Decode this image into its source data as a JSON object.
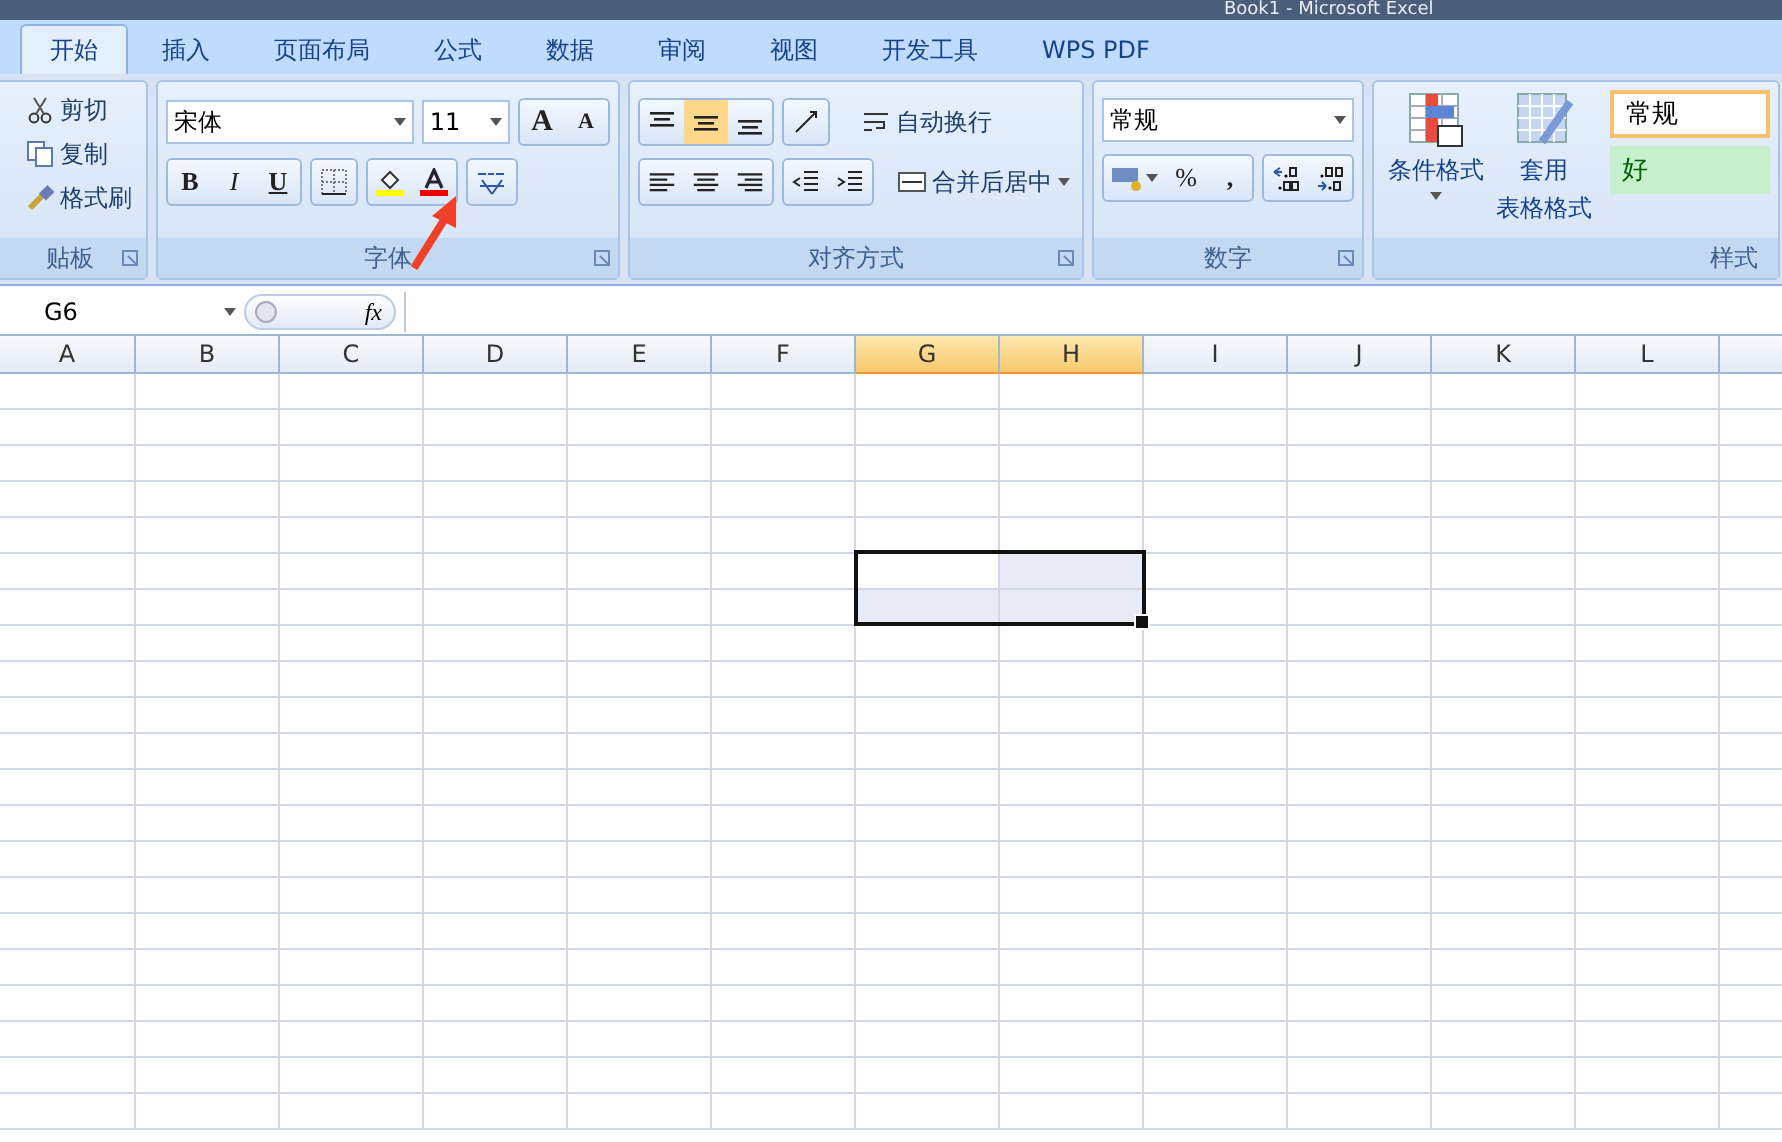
{
  "window": {
    "title": "Book1 - Microsoft Excel"
  },
  "tabs": [
    {
      "label": "开始",
      "selected": true
    },
    {
      "label": "插入",
      "selected": false
    },
    {
      "label": "页面布局",
      "selected": false
    },
    {
      "label": "公式",
      "selected": false
    },
    {
      "label": "数据",
      "selected": false
    },
    {
      "label": "审阅",
      "selected": false
    },
    {
      "label": "视图",
      "selected": false
    },
    {
      "label": "开发工具",
      "selected": false
    },
    {
      "label": "WPS PDF",
      "selected": false
    }
  ],
  "clipboard": {
    "items": [
      "剪切",
      "复制",
      "格式刷"
    ],
    "label": "贴板"
  },
  "font": {
    "name": "宋体",
    "size": "11",
    "grow": "A",
    "shrink": "A",
    "bold": "B",
    "italic": "I",
    "underline": "U",
    "label": "字体"
  },
  "alignment": {
    "vertical": [
      {
        "selected": false
      },
      {
        "selected": true
      },
      {
        "selected": false
      }
    ],
    "wrap": "自动换行",
    "merge": "合并后居中",
    "label": "对齐方式"
  },
  "number": {
    "format": "常规",
    "percent": "%",
    "comma": ",",
    "label": "数字"
  },
  "styles": {
    "conditional": "条件格式",
    "table_1": "套用",
    "table_2": "表格格式",
    "cell_styles": [
      {
        "label": "常规",
        "kind": "normal"
      },
      {
        "label": "好",
        "kind": "good"
      }
    ],
    "label": "样式"
  },
  "formula_bar": {
    "name_box": "G6",
    "fx": "fx"
  },
  "columns": [
    {
      "label": "A",
      "selected": false
    },
    {
      "label": "B",
      "selected": false
    },
    {
      "label": "C",
      "selected": false
    },
    {
      "label": "D",
      "selected": false
    },
    {
      "label": "E",
      "selected": false
    },
    {
      "label": "F",
      "selected": false
    },
    {
      "label": "G",
      "selected": true
    },
    {
      "label": "H",
      "selected": true
    },
    {
      "label": "I",
      "selected": false
    },
    {
      "label": "J",
      "selected": false
    },
    {
      "label": "K",
      "selected": false
    },
    {
      "label": "L",
      "selected": false
    }
  ],
  "rows": [
    {
      "selected": false
    },
    {
      "selected": false
    },
    {
      "selected": false
    },
    {
      "selected": false
    },
    {
      "selected": false
    },
    {
      "selected": true,
      "active": true
    },
    {
      "selected": true,
      "active": false
    },
    {
      "selected": false
    },
    {
      "selected": false
    },
    {
      "selected": false
    },
    {
      "selected": false
    },
    {
      "selected": false
    },
    {
      "selected": false
    },
    {
      "selected": false
    },
    {
      "selected": false
    },
    {
      "selected": false
    },
    {
      "selected": false
    },
    {
      "selected": false
    },
    {
      "selected": false
    },
    {
      "selected": false
    },
    {
      "selected": false
    }
  ]
}
